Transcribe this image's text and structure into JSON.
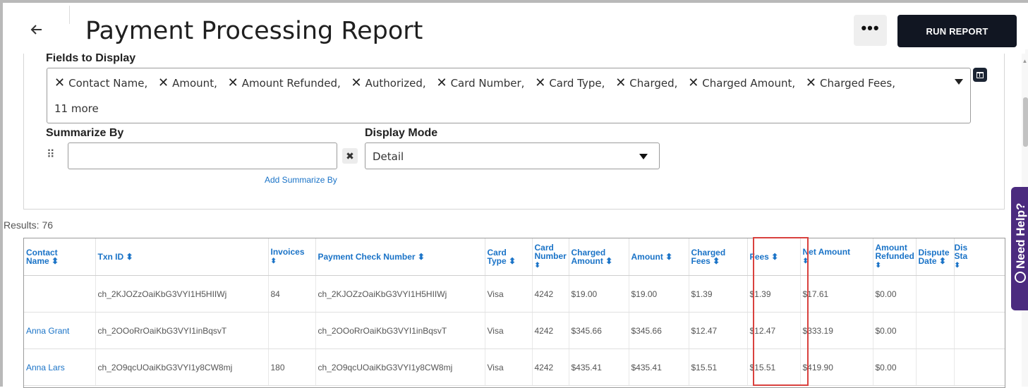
{
  "header": {
    "title": "Payment Processing Report",
    "more_label": "•••",
    "run_label": "RUN REPORT"
  },
  "fields_to_display": {
    "label": "Fields to Display",
    "chips": [
      "Contact Name,",
      "Amount,",
      "Amount Refunded,",
      "Authorized,",
      "Card Number,",
      "Card Type,",
      "Charged,",
      "Charged Amount,",
      "Charged Fees,"
    ],
    "more": "11 more"
  },
  "summarize_by": {
    "label": "Summarize By",
    "value": "",
    "add_label": "Add Summarize By"
  },
  "display_mode": {
    "label": "Display Mode",
    "value": "Detail"
  },
  "results": {
    "label": "Results: 76"
  },
  "table": {
    "columns": [
      {
        "l1": "Contact",
        "l2": "Name ⬍"
      },
      {
        "l1": "Txn ID ⬍",
        "l2": ""
      },
      {
        "l1": "Invoices",
        "l2": "⬍"
      },
      {
        "l1": "Payment Check Number ⬍",
        "l2": ""
      },
      {
        "l1": "Card",
        "l2": "Type ⬍"
      },
      {
        "l1": "Card",
        "l2": "Number",
        "l3": "⬍"
      },
      {
        "l1": "Charged",
        "l2": "Amount ⬍"
      },
      {
        "l1": "Amount ⬍",
        "l2": ""
      },
      {
        "l1": "Charged",
        "l2": "Fees ⬍"
      },
      {
        "l1": "Fees ⬍",
        "l2": ""
      },
      {
        "l1": "Net Amount",
        "l2": "⬍"
      },
      {
        "l1": "Amount",
        "l2": "Refunded",
        "l3": "⬍"
      },
      {
        "l1": "Dispute",
        "l2": "Date ⬍"
      },
      {
        "l1": "Dis",
        "l2": "Sta",
        "l3": "⬍"
      }
    ],
    "rows": [
      {
        "name": "",
        "txn": "ch_2KJOZzOaiKbG3VYI1H5HIIWj",
        "invoices": "84",
        "check": "ch_2KJOZzOaiKbG3VYI1H5HIIWj",
        "card_type": "Visa",
        "card_number": "4242",
        "charged_amount": "$19.00",
        "amount": "$19.00",
        "charged_fees": "$1.39",
        "fees": "$1.39",
        "net": "$17.61",
        "refunded": "$0.00",
        "dispute_date": "",
        "dispute_status": ""
      },
      {
        "name": "Anna Grant",
        "txn": "ch_2OOoRrOaiKbG3VYI1inBqsvT",
        "invoices": "",
        "check": "ch_2OOoRrOaiKbG3VYI1inBqsvT",
        "card_type": "Visa",
        "card_number": "4242",
        "charged_amount": "$345.66",
        "amount": "$345.66",
        "charged_fees": "$12.47",
        "fees": "$12.47",
        "net": "$333.19",
        "refunded": "$0.00",
        "dispute_date": "",
        "dispute_status": ""
      },
      {
        "name": "Anna Lars",
        "txn": "ch_2O9qcUOaiKbG3VYI1y8CW8mj",
        "invoices": "180",
        "check": "ch_2O9qcUOaiKbG3VYI1y8CW8mj",
        "card_type": "Visa",
        "card_number": "4242",
        "charged_amount": "$435.41",
        "amount": "$435.41",
        "charged_fees": "$15.51",
        "fees": "$15.51",
        "net": "$419.90",
        "refunded": "$0.00",
        "dispute_date": "",
        "dispute_status": ""
      }
    ]
  },
  "help": {
    "label": "Need Help?"
  },
  "colors": {
    "accent": "#1a73c7",
    "primary_button": "#111622",
    "highlight": "#d9413e",
    "help_tab": "#4b2b7f"
  },
  "icons": [
    "back-arrow-icon",
    "more-icon",
    "remove-chip-icon",
    "dropdown-caret-icon",
    "column-toggle-icon",
    "drag-handle-icon",
    "clear-icon",
    "sort-icon",
    "help-icon"
  ]
}
